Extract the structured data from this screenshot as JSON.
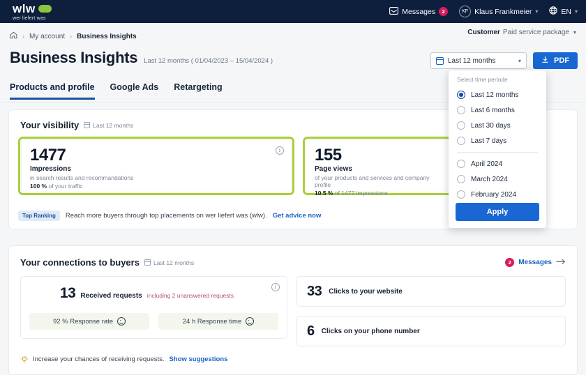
{
  "topnav": {
    "logo_word": "wlw",
    "logo_sub": "wer liefert was",
    "messages_label": "Messages",
    "messages_count": "2",
    "user_initials": "KF",
    "user_name": "Klaus Frankmeier",
    "language": "EN"
  },
  "customer_bar": {
    "label": "Customer",
    "value": "Paid service package"
  },
  "breadcrumb": {
    "home_icon": "home-icon",
    "account": "My account",
    "current": "Business Insights"
  },
  "page": {
    "title": "Business Insights",
    "date_range": "Last 12 months ( 01/04/2023 – 15/04/2024 )"
  },
  "tabs": [
    {
      "label": "Products and profile",
      "active": true
    },
    {
      "label": "Google Ads",
      "active": false
    },
    {
      "label": "Retargeting",
      "active": false
    }
  ],
  "period_control": {
    "selected": "Last 12 months",
    "pdf_label": "PDF"
  },
  "dropdown": {
    "title": "Select time periode",
    "options": [
      {
        "label": "Last 12 months",
        "selected": true
      },
      {
        "label": "Last 6 months",
        "selected": false
      },
      {
        "label": "Last 30 days",
        "selected": false
      },
      {
        "label": "Last 7 days",
        "selected": false
      }
    ],
    "month_options": [
      {
        "label": "April 2024",
        "selected": false
      },
      {
        "label": "March 2024",
        "selected": false
      },
      {
        "label": "February 2024",
        "selected": false
      }
    ],
    "apply_label": "Apply"
  },
  "visibility": {
    "heading": "Your visibility",
    "period": "Last 12 months",
    "metrics": [
      {
        "value": "1477",
        "label": "Impressions",
        "description": "in search results and recommandations",
        "pct": "100 %",
        "pct_suffix": "of your traffic"
      },
      {
        "value": "155",
        "label": "Page views",
        "description": "of your products and services and company profile",
        "pct": "10.5 %",
        "pct_suffix": "of 1477 impressions"
      }
    ],
    "promo": {
      "badge": "Top Ranking",
      "text": "Reach more buyers through top placements on  wer liefert was (wlw).",
      "link": "Get advice now"
    }
  },
  "connections": {
    "heading": "Your connections to buyers",
    "period": "Last 12 months",
    "messages_link": "Messages",
    "messages_count": "2",
    "requests": {
      "value": "13",
      "label": "Received requests",
      "extra": "including 2 unanswered requests",
      "pills": [
        {
          "text": "92 % Response rate"
        },
        {
          "text": "24 h Response time"
        }
      ]
    },
    "clicks": [
      {
        "value": "33",
        "label": "Clicks to your website"
      },
      {
        "value": "6",
        "label": "Clicks on your phone number"
      }
    ],
    "suggestion": {
      "text": "Increase your chances of receiving requests.",
      "link": "Show suggestions"
    }
  },
  "colors": {
    "navy": "#0d1f3c",
    "green_highlight": "#a9cf38",
    "accent_blue": "#1967d2",
    "badge_red": "#d81b60"
  }
}
